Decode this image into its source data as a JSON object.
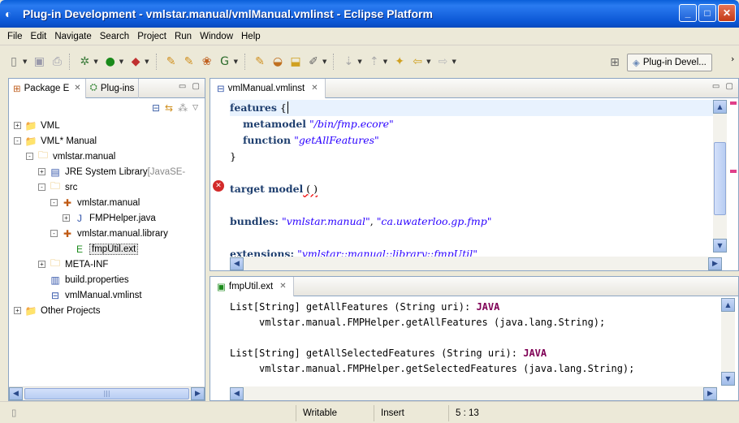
{
  "window": {
    "title": "Plug-in Development - vmlstar.manual/vmlManual.vmlinst - Eclipse Platform"
  },
  "menu": [
    "File",
    "Edit",
    "Navigate",
    "Search",
    "Project",
    "Run",
    "Window",
    "Help"
  ],
  "toolbar": {
    "perspective_label": "Plug-in Devel..."
  },
  "left_panel": {
    "tabs": [
      {
        "label": "Package E"
      },
      {
        "label": "Plug-ins"
      }
    ],
    "tree": [
      {
        "label": "VML",
        "expander": "+",
        "icon": "project-folder-icon",
        "level": 0
      },
      {
        "label": "VML* Manual",
        "expander": "−",
        "icon": "project-folder-icon",
        "level": 0
      },
      {
        "label": "vmlstar.manual",
        "expander": "−",
        "icon": "plugin-project-icon",
        "level": 1
      },
      {
        "label": "JRE System Library",
        "suffix": " [JavaSE-",
        "expander": "+",
        "icon": "library-icon",
        "level": 2
      },
      {
        "label": "src",
        "expander": "−",
        "icon": "source-folder-icon",
        "level": 2
      },
      {
        "label": "vmlstar.manual",
        "expander": "−",
        "icon": "package-icon",
        "level": 3
      },
      {
        "label": "FMPHelper.java",
        "expander": "+",
        "icon": "java-file-icon",
        "level": 4
      },
      {
        "label": "vmlstar.manual.library",
        "expander": "−",
        "icon": "package-icon",
        "level": 3
      },
      {
        "label": "fmpUtil.ext",
        "expander": "",
        "icon": "ext-file-icon",
        "level": 4,
        "selected": true
      },
      {
        "label": "META-INF",
        "expander": "+",
        "icon": "folder-icon",
        "level": 2
      },
      {
        "label": "build.properties",
        "expander": "",
        "icon": "properties-file-icon",
        "level": 2
      },
      {
        "label": "vmlManual.vmlinst",
        "expander": "",
        "icon": "vmlinst-file-icon",
        "level": 2
      },
      {
        "label": "Other Projects",
        "expander": "+",
        "icon": "project-folder-icon",
        "level": 0
      }
    ]
  },
  "editor_top": {
    "tab_label": "vmlManual.vmlinst",
    "lines": [
      {
        "segments": [
          {
            "t": "features",
            "c": "plain"
          },
          {
            "t": " {",
            "c": ""
          }
        ],
        "indent": 0,
        "current": true
      },
      {
        "segments": [
          {
            "t": "metamodel",
            "c": "plain"
          },
          {
            "t": " ",
            "c": ""
          },
          {
            "t": "\"/bin/fmp.ecore\"",
            "c": "str"
          }
        ],
        "indent": 1
      },
      {
        "segments": [
          {
            "t": "function",
            "c": "plain"
          },
          {
            "t": " ",
            "c": ""
          },
          {
            "t": "\"getAllFeatures\"",
            "c": "str"
          }
        ],
        "indent": 1
      },
      {
        "segments": [
          {
            "t": "}",
            "c": ""
          }
        ],
        "indent": 0
      },
      {
        "segments": [
          {
            "t": "",
            "c": ""
          }
        ],
        "indent": 0
      },
      {
        "segments": [
          {
            "t": "target model",
            "c": "plain"
          },
          {
            "t": " ( )",
            "c": "err"
          }
        ],
        "indent": 0
      },
      {
        "segments": [
          {
            "t": "",
            "c": ""
          }
        ],
        "indent": 0
      },
      {
        "segments": [
          {
            "t": "bundles:",
            "c": "plain"
          },
          {
            "t": " ",
            "c": ""
          },
          {
            "t": "\"vmlstar.manual\"",
            "c": "str"
          },
          {
            "t": ", ",
            "c": ""
          },
          {
            "t": "\"ca.uwaterloo.gp.fmp\"",
            "c": "str"
          }
        ],
        "indent": 0
      },
      {
        "segments": [
          {
            "t": "",
            "c": ""
          }
        ],
        "indent": 0
      },
      {
        "segments": [
          {
            "t": "extensions:",
            "c": "plain"
          },
          {
            "t": " ",
            "c": ""
          },
          {
            "t": "\"vmlstar::manual::library::fmpUtil\"",
            "c": "str"
          }
        ],
        "indent": 0
      }
    ]
  },
  "editor_bottom": {
    "tab_label": "fmpUtil.ext",
    "lines": [
      {
        "segments": [
          {
            "t": "List[String] getAllFeatures (String uri): ",
            "c": ""
          },
          {
            "t": "JAVA",
            "c": "kw"
          }
        ],
        "indent": 0
      },
      {
        "segments": [
          {
            "t": "vmlstar.manual.FMPHelper.getAllFeatures (java.lang.String);",
            "c": ""
          }
        ],
        "indent": 1
      },
      {
        "segments": [
          {
            "t": "",
            "c": ""
          }
        ],
        "indent": 0
      },
      {
        "segments": [
          {
            "t": "List[String] getAllSelectedFeatures (String uri): ",
            "c": ""
          },
          {
            "t": "JAVA",
            "c": "kw"
          }
        ],
        "indent": 0
      },
      {
        "segments": [
          {
            "t": "vmlstar.manual.FMPHelper.getSelectedFeatures (java.lang.String);",
            "c": ""
          }
        ],
        "indent": 1
      }
    ]
  },
  "status": {
    "writable": "Writable",
    "insert": "Insert",
    "position": "5 : 13"
  },
  "colors": {
    "keyword": "#7f0055",
    "string": "#2a00ff",
    "current_line": "#e8f2fe",
    "title_blue": "#0b56d4"
  }
}
